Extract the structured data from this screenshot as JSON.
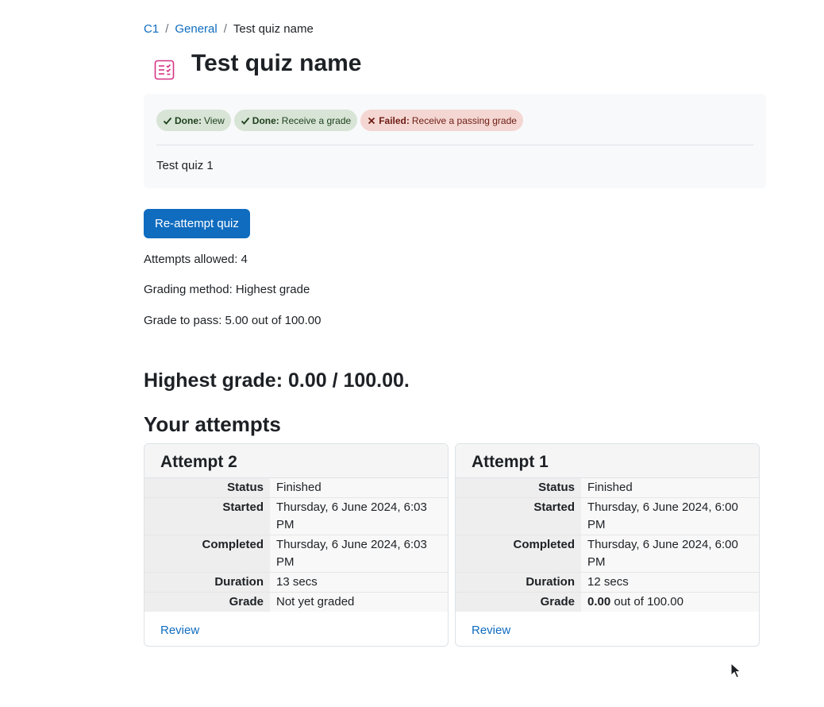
{
  "breadcrumb": {
    "items": [
      "C1",
      "General"
    ],
    "current": "Test quiz name"
  },
  "header": {
    "title": "Test quiz name",
    "icon": "quiz-icon"
  },
  "completion": {
    "badges": [
      {
        "status": "Done:",
        "label": "View",
        "state": "done"
      },
      {
        "status": "Done:",
        "label": "Receive a grade",
        "state": "done"
      },
      {
        "status": "Failed:",
        "label": "Receive a passing grade",
        "state": "failed"
      }
    ]
  },
  "intro": "Test quiz 1",
  "actions": {
    "reattempt_label": "Re-attempt quiz"
  },
  "quiz_info": {
    "attempts_allowed": "Attempts allowed: 4",
    "grading_method": "Grading method: Highest grade",
    "grade_to_pass": "Grade to pass: 5.00 out of 100.00"
  },
  "highest_grade": "Highest grade: 0.00 / 100.00.",
  "attempts_heading": "Your attempts",
  "attempts": [
    {
      "title": "Attempt 2",
      "rows": {
        "status_label": "Status",
        "status": "Finished",
        "started_label": "Started",
        "started": "Thursday, 6 June 2024, 6:03 PM",
        "completed_label": "Completed",
        "completed": "Thursday, 6 June 2024, 6:03 PM",
        "duration_label": "Duration",
        "duration": "13 secs",
        "grade_label": "Grade",
        "grade_bold": "",
        "grade_rest": "Not yet graded"
      },
      "review_label": "Review"
    },
    {
      "title": "Attempt 1",
      "rows": {
        "status_label": "Status",
        "status": "Finished",
        "started_label": "Started",
        "started": "Thursday, 6 June 2024, 6:00 PM",
        "completed_label": "Completed",
        "completed": "Thursday, 6 June 2024, 6:00 PM",
        "duration_label": "Duration",
        "duration": "12 secs",
        "grade_label": "Grade",
        "grade_bold": "0.00",
        "grade_rest": " out of 100.00"
      },
      "review_label": "Review"
    }
  ],
  "colors": {
    "primary": "#0f6cbf",
    "quiz_icon": "#d63384",
    "done_badge": "#d7e4d6",
    "failed_badge": "#f4d6d2"
  }
}
